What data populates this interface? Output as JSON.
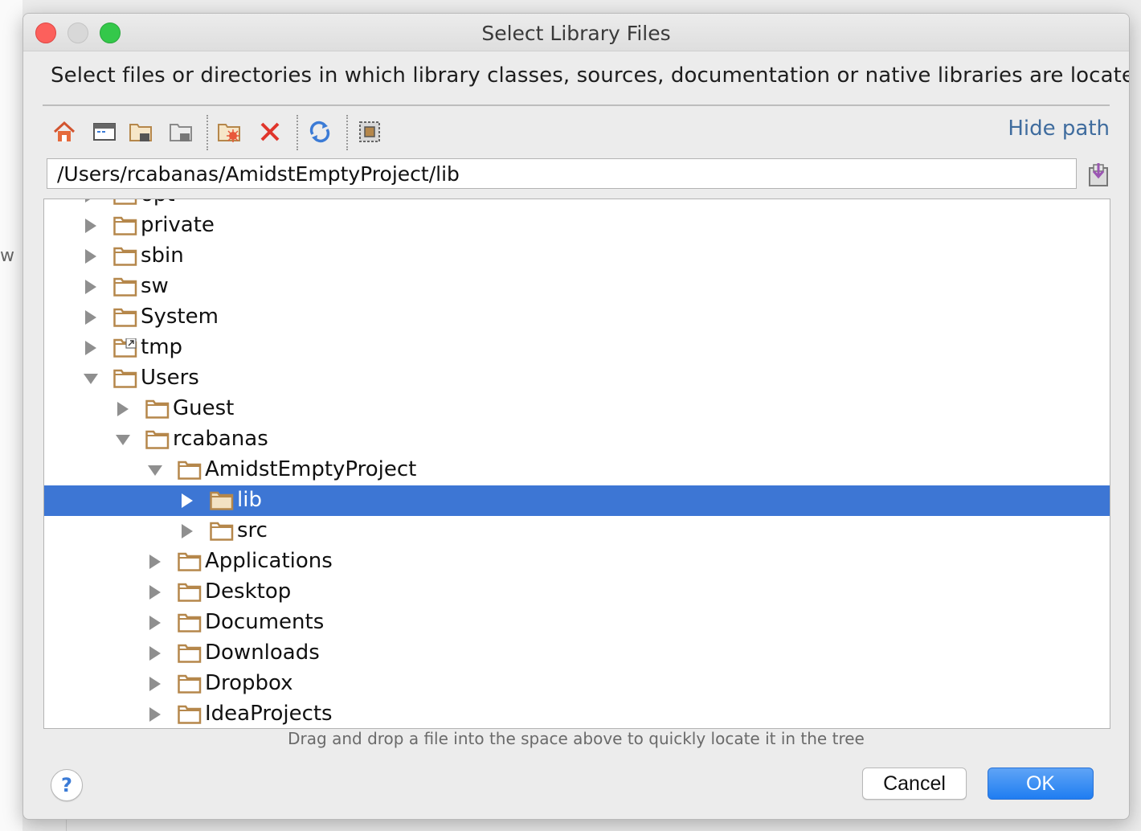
{
  "window": {
    "title": "Select Library Files",
    "description": "Select files or directories in which library classes, sources, documentation or native libraries are located"
  },
  "background": {
    "partial_text": "w"
  },
  "toolbar": {
    "icons": [
      "home-icon",
      "desktop-icon",
      "project-folder-icon",
      "module-folder-icon",
      "new-folder-icon",
      "delete-icon",
      "refresh-icon",
      "show-hidden-icon"
    ],
    "hide_path_label": "Hide path"
  },
  "path": {
    "value": "/Users/rcabanas/AmidstEmptyProject/lib"
  },
  "tree": {
    "rows": [
      {
        "label": "opt",
        "level": 0,
        "expanded": false,
        "selected": false,
        "partial": true
      },
      {
        "label": "private",
        "level": 0,
        "expanded": false,
        "selected": false
      },
      {
        "label": "sbin",
        "level": 0,
        "expanded": false,
        "selected": false
      },
      {
        "label": "sw",
        "level": 0,
        "expanded": false,
        "selected": false
      },
      {
        "label": "System",
        "level": 0,
        "expanded": false,
        "selected": false
      },
      {
        "label": "tmp",
        "level": 0,
        "expanded": false,
        "selected": false,
        "symlink": true
      },
      {
        "label": "Users",
        "level": 0,
        "expanded": true,
        "selected": false
      },
      {
        "label": "Guest",
        "level": 1,
        "expanded": false,
        "selected": false
      },
      {
        "label": "rcabanas",
        "level": 1,
        "expanded": true,
        "selected": false
      },
      {
        "label": "AmidstEmptyProject",
        "level": 2,
        "expanded": true,
        "selected": false
      },
      {
        "label": "lib",
        "level": 3,
        "expanded": false,
        "selected": true
      },
      {
        "label": "src",
        "level": 3,
        "expanded": false,
        "selected": false
      },
      {
        "label": "Applications",
        "level": 2,
        "expanded": false,
        "selected": false
      },
      {
        "label": "Desktop",
        "level": 2,
        "expanded": false,
        "selected": false
      },
      {
        "label": "Documents",
        "level": 2,
        "expanded": false,
        "selected": false
      },
      {
        "label": "Downloads",
        "level": 2,
        "expanded": false,
        "selected": false
      },
      {
        "label": "Dropbox",
        "level": 2,
        "expanded": false,
        "selected": false
      },
      {
        "label": "IdeaProjects",
        "level": 2,
        "expanded": false,
        "selected": false
      }
    ]
  },
  "hint": "Drag and drop a file into the space above to quickly locate it in the tree",
  "buttons": {
    "help": "?",
    "cancel": "Cancel",
    "ok": "OK"
  },
  "colors": {
    "selection": "#3d76d4",
    "folder": "#b5874b",
    "accent_link": "#3f6c9e",
    "ok_button": "#1f7df1"
  }
}
